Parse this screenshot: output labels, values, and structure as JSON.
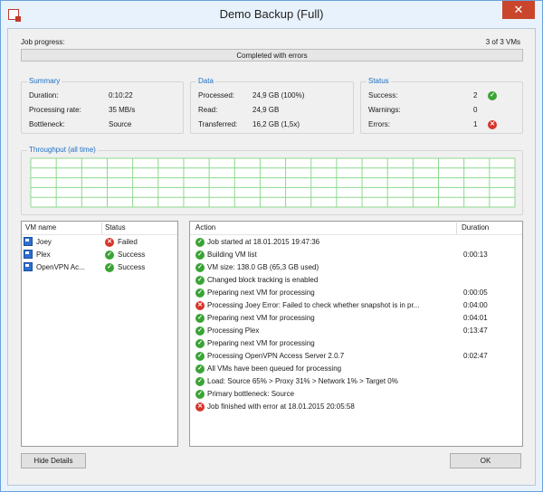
{
  "window": {
    "title": "Demo Backup (Full)",
    "close_glyph": "✕"
  },
  "progress": {
    "label": "Job progress:",
    "count": "3 of 3 VMs",
    "status": "Completed with errors",
    "fraction": 1.0
  },
  "summary": {
    "title": "Summary",
    "rows": [
      {
        "label": "Duration:",
        "value": "0:10:22"
      },
      {
        "label": "Processing rate:",
        "value": "35 MB/s"
      },
      {
        "label": "Bottleneck:",
        "value": "Source"
      }
    ]
  },
  "data_group": {
    "title": "Data",
    "rows": [
      {
        "label": "Processed:",
        "value": "24,9 GB (100%)"
      },
      {
        "label": "Read:",
        "value": "24,9 GB"
      },
      {
        "label": "Transferred:",
        "value": "16,2 GB (1,5x)"
      }
    ]
  },
  "status_group": {
    "title": "Status",
    "rows": [
      {
        "label": "Success:",
        "value": "2",
        "icon": "success-icon"
      },
      {
        "label": "Warnings:",
        "value": "0",
        "icon": ""
      },
      {
        "label": "Errors:",
        "value": "1",
        "icon": "error-icon"
      }
    ]
  },
  "throughput": {
    "title": "Throughput (all time)",
    "grid_color": "#8ed88e"
  },
  "vm_list": {
    "headers": {
      "name": "VM name",
      "status": "Status"
    },
    "rows": [
      {
        "name": "Joey",
        "status": "Failed",
        "state": "error"
      },
      {
        "name": "Plex",
        "status": "Success",
        "state": "ok"
      },
      {
        "name": "OpenVPN Ac...",
        "status": "Success",
        "state": "ok"
      }
    ]
  },
  "actions": {
    "headers": {
      "action": "Action",
      "duration": "Duration"
    },
    "rows": [
      {
        "text": "Job started at 18.01.2015 19:47:36",
        "duration": "",
        "state": "ok"
      },
      {
        "text": "Building VM list",
        "duration": "0:00:13",
        "state": "ok"
      },
      {
        "text": "VM size: 138.0 GB (65,3 GB used)",
        "duration": "",
        "state": "ok"
      },
      {
        "text": "Changed block tracking is enabled",
        "duration": "",
        "state": "ok"
      },
      {
        "text": "Preparing next VM for processing",
        "duration": "0:00:05",
        "state": "ok"
      },
      {
        "text": "Processing Joey Error: Failed to check whether snapshot is in pr...",
        "duration": "0:04:00",
        "state": "error"
      },
      {
        "text": "Preparing next VM for processing",
        "duration": "0:04:01",
        "state": "ok"
      },
      {
        "text": "Processing Plex",
        "duration": "0:13:47",
        "state": "ok"
      },
      {
        "text": "Preparing next VM for processing",
        "duration": "",
        "state": "ok"
      },
      {
        "text": "Processing OpenVPN Access Server 2.0.7",
        "duration": "0:02:47",
        "state": "ok"
      },
      {
        "text": "All VMs have been queued for processing",
        "duration": "",
        "state": "ok"
      },
      {
        "text": "Load: Source 65% > Proxy 31% > Network 1% > Target 0%",
        "duration": "",
        "state": "ok"
      },
      {
        "text": "Primary bottleneck: Source",
        "duration": "",
        "state": "ok"
      },
      {
        "text": "Job finished with error at 18.01.2015 20:05:58",
        "duration": "",
        "state": "error"
      }
    ]
  },
  "buttons": {
    "hide_details": "Hide Details",
    "ok": "OK"
  }
}
